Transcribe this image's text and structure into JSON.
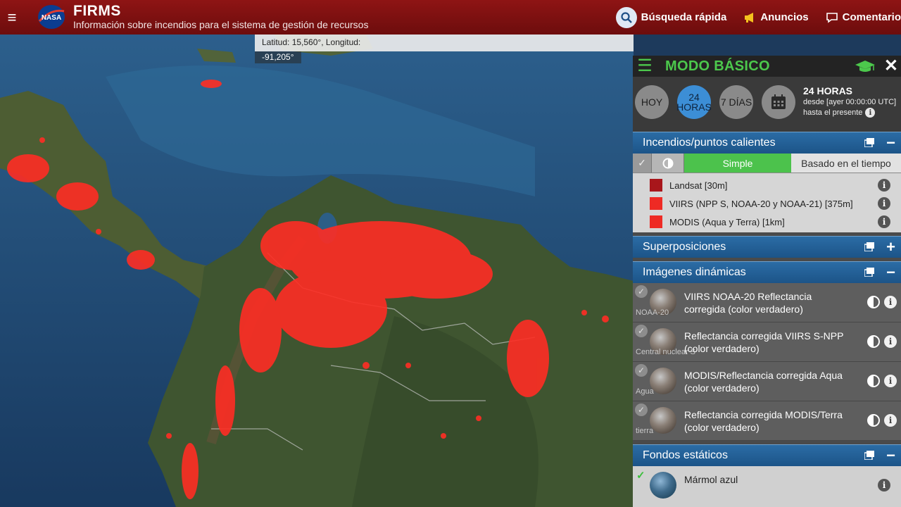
{
  "header": {
    "logo_text": "NASA",
    "title": "FIRMS",
    "subtitle": "Información sobre incendios para el sistema de gestión de recursos",
    "nav": [
      {
        "label": "Búsqueda rápida",
        "icon": "search-icon"
      },
      {
        "label": "Anuncios",
        "icon": "megaphone-icon"
      },
      {
        "label": "Comentario",
        "icon": "comment-icon"
      }
    ]
  },
  "map": {
    "coord_line1": "Latitud: 15,560°, Longitud:",
    "coord_line2": "-91,205°"
  },
  "panel": {
    "title": "MODO BÁSICO",
    "time_buttons": [
      {
        "label": "HOY",
        "active": false
      },
      {
        "label": "24 HORAS",
        "active": true
      },
      {
        "label": "7 DÍAS",
        "active": false
      }
    ],
    "time_title": "24 HORAS",
    "time_from": "desde [ayer 00:00:00 UTC]",
    "time_to": "hasta el presente",
    "fires": {
      "title": "Incendios/puntos calientes",
      "mode_simple": "Simple",
      "mode_time": "Basado en el tiempo",
      "legend": [
        {
          "label": "Landsat [30m]",
          "color": "#a8161b"
        },
        {
          "label": "VIIRS (NPP S, NOAA-20 y NOAA-21) [375m]",
          "color": "#ee2a24"
        },
        {
          "label": "MODIS (Aqua y Terra) [1km]",
          "color": "#ee2a24"
        }
      ]
    },
    "overlays": {
      "title": "Superposiciones"
    },
    "dynamic": {
      "title": "Imágenes dinámicas",
      "layers": [
        {
          "name": "VIIRS NOAA-20 Reflectancia corregida (color verdadero)",
          "sub": "NOAA-20"
        },
        {
          "name": "Reflectancia corregida VIIRS S-NPP (color verdadero)",
          "sub": "Central nuclear S"
        },
        {
          "name": "MODIS/Reflectancia corregida Aqua (color verdadero)",
          "sub": "Agua"
        },
        {
          "name": "Reflectancia corregida MODIS/Terra (color verdadero)",
          "sub": "tierra"
        }
      ]
    },
    "static": {
      "title": "Fondos estáticos",
      "layers": [
        {
          "name": "Mármol azul"
        }
      ]
    }
  },
  "colors": {
    "header_red": "#8e1414",
    "accent_green": "#4cc84c",
    "section_blue": "#1c5488",
    "fire_red": "#ff2d24"
  }
}
